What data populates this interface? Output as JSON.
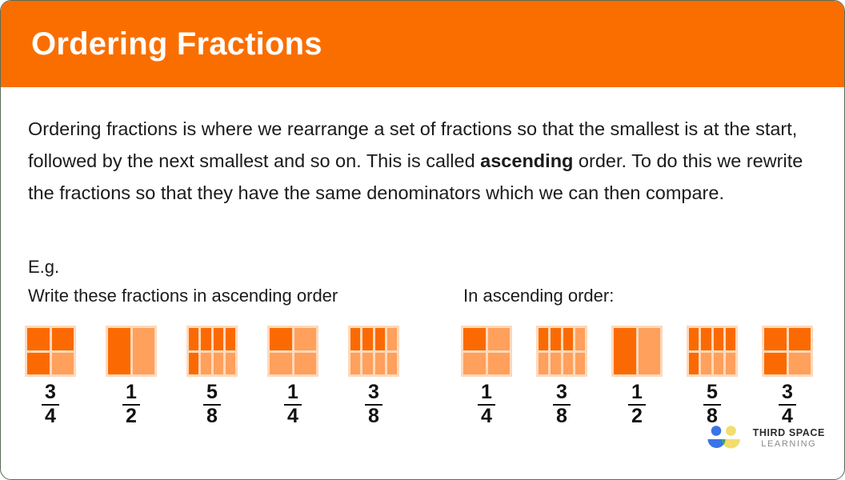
{
  "header": {
    "title": "Ordering Fractions",
    "background": "#fa6e00",
    "text_color": "#ffffff"
  },
  "intro": {
    "part1": "Ordering fractions is where we rearrange a set of fractions so that the smallest is at the start, followed by the next smallest and so on. This is called ",
    "bold": "ascending",
    "part2": " order. To do this we rewrite the fractions so that they have the same denominators which we can then compare."
  },
  "example": {
    "eg_label": "E.g.",
    "prompt_left": "Write these fractions in ascending order",
    "prompt_right": "In ascending order:"
  },
  "colors": {
    "filled": "#fb6a02",
    "unfilled": "#ffa05c",
    "gridline": "#ffd9ba"
  },
  "chart_data": {
    "type": "bar",
    "title": "Fraction area models — unordered vs ascending order",
    "unordered": {
      "label": "Write these fractions in ascending order",
      "items": [
        {
          "numerator": "3",
          "denominator": "4",
          "value": 0.75,
          "cols": 2,
          "rows": 2,
          "filled": 3,
          "total": 4
        },
        {
          "numerator": "1",
          "denominator": "2",
          "value": 0.5,
          "cols": 2,
          "rows": 1,
          "filled": 1,
          "total": 2
        },
        {
          "numerator": "5",
          "denominator": "8",
          "value": 0.625,
          "cols": 4,
          "rows": 2,
          "filled": 5,
          "total": 8
        },
        {
          "numerator": "1",
          "denominator": "4",
          "value": 0.25,
          "cols": 2,
          "rows": 2,
          "filled": 1,
          "total": 4
        },
        {
          "numerator": "3",
          "denominator": "8",
          "value": 0.375,
          "cols": 4,
          "rows": 2,
          "filled": 3,
          "total": 8
        }
      ]
    },
    "ordered": {
      "label": "In ascending order:",
      "items": [
        {
          "numerator": "1",
          "denominator": "4",
          "value": 0.25,
          "cols": 2,
          "rows": 2,
          "filled": 1,
          "total": 4
        },
        {
          "numerator": "3",
          "denominator": "8",
          "value": 0.375,
          "cols": 4,
          "rows": 2,
          "filled": 3,
          "total": 8
        },
        {
          "numerator": "1",
          "denominator": "2",
          "value": 0.5,
          "cols": 2,
          "rows": 1,
          "filled": 1,
          "total": 2
        },
        {
          "numerator": "5",
          "denominator": "8",
          "value": 0.625,
          "cols": 4,
          "rows": 2,
          "filled": 5,
          "total": 8
        },
        {
          "numerator": "3",
          "denominator": "4",
          "value": 0.75,
          "cols": 2,
          "rows": 2,
          "filled": 3,
          "total": 4
        }
      ]
    }
  },
  "logo": {
    "line1": "THIRD SPACE",
    "line2": "LEARNING",
    "blue": "#3b74e8",
    "yellow": "#f2dd6e",
    "green": "#35a86b"
  }
}
